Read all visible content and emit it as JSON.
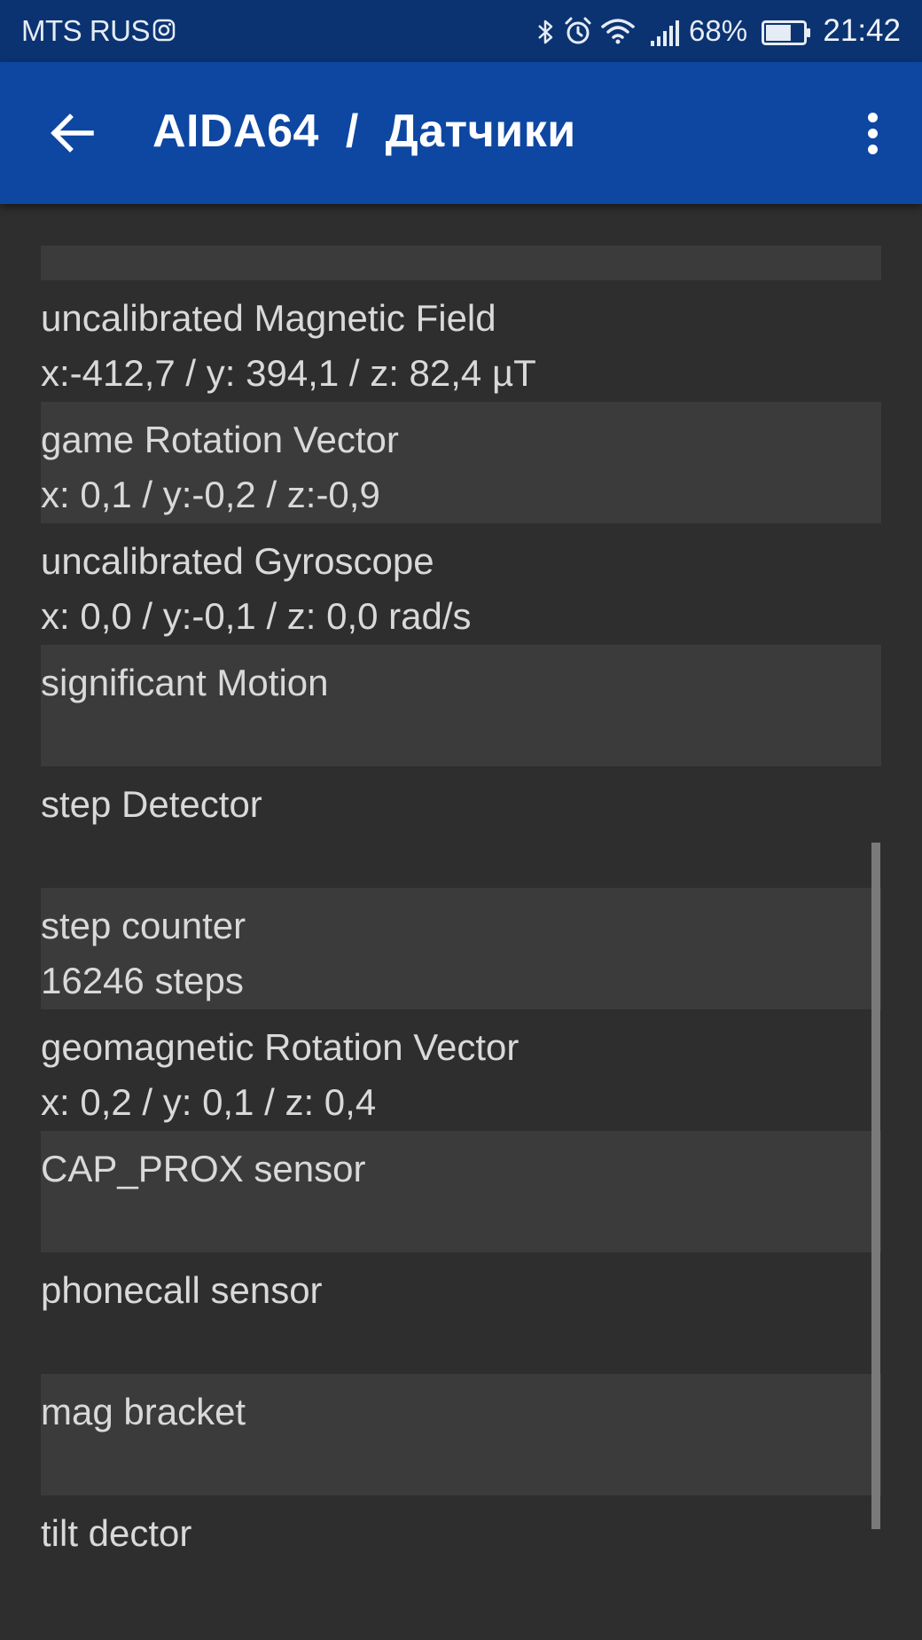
{
  "status_bar": {
    "carrier": "MTS RUS",
    "battery_percent": "68%",
    "battery_level": 0.68,
    "time": "21:42",
    "icons": [
      "instagram-icon",
      "bluetooth-icon",
      "alarm-icon",
      "wifi-icon",
      "signal-icon",
      "battery-icon"
    ]
  },
  "app_bar": {
    "title": "AIDA64  /  Датчики",
    "back_icon": "arrow-back-icon",
    "menu_icon": "more-vert-icon"
  },
  "sensors": [
    {
      "name": "uncalibrated Magnetic Field",
      "value": "x:-412,7 / y: 394,1 / z: 82,4 µT",
      "shaded": false
    },
    {
      "name": "game Rotation Vector",
      "value": "x: 0,1 / y:-0,2 / z:-0,9",
      "shaded": true
    },
    {
      "name": "uncalibrated Gyroscope",
      "value": "x: 0,0 / y:-0,1 / z: 0,0 rad/s",
      "shaded": false
    },
    {
      "name": "significant Motion",
      "value": "",
      "shaded": true
    },
    {
      "name": "step Detector",
      "value": "",
      "shaded": false
    },
    {
      "name": "step counter",
      "value": "16246 steps",
      "shaded": true
    },
    {
      "name": "geomagnetic Rotation Vector",
      "value": "x: 0,2 / y: 0,1 / z: 0,4",
      "shaded": false
    },
    {
      "name": "CAP_PROX sensor",
      "value": "",
      "shaded": true
    },
    {
      "name": "phonecall sensor",
      "value": "",
      "shaded": false
    },
    {
      "name": "mag bracket",
      "value": "",
      "shaded": true
    },
    {
      "name": "tilt dector",
      "value": "",
      "shaded": false
    }
  ],
  "colors": {
    "status_bar": "#0b3371",
    "app_bar": "#0d47a1",
    "background": "#2e2e2e",
    "row_shaded": "#3b3b3b",
    "text": "#d9d9d9"
  }
}
